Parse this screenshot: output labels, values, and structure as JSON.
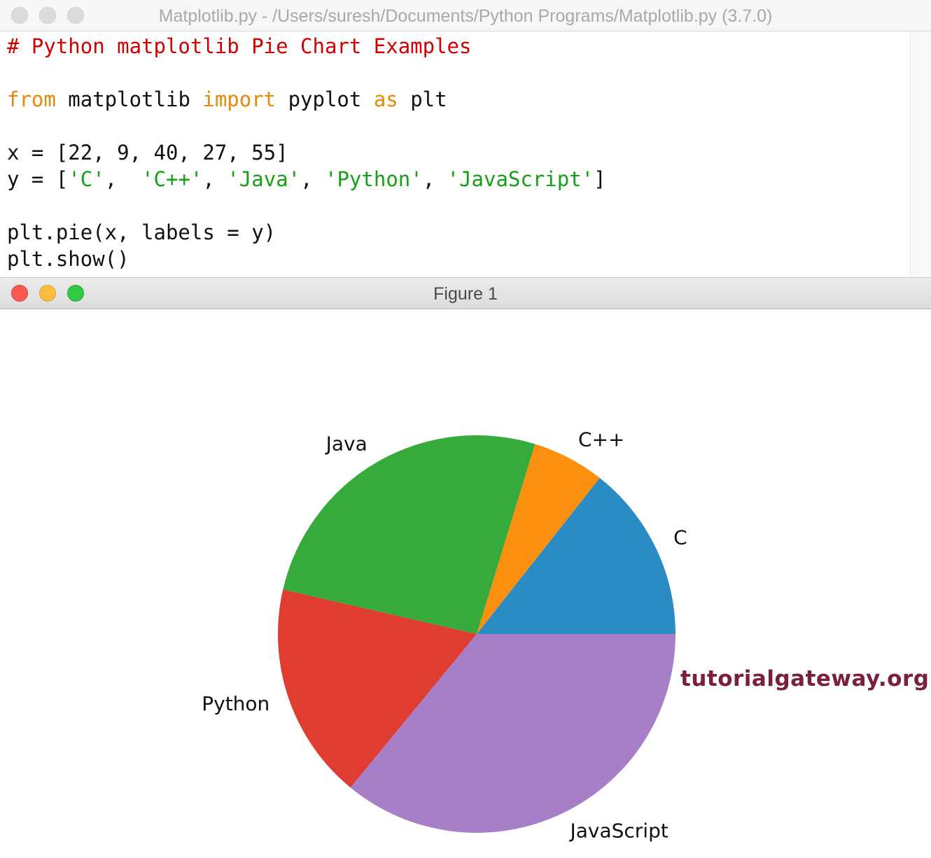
{
  "editor": {
    "title": "Matplotlib.py - /Users/suresh/Documents/Python Programs/Matplotlib.py (3.7.0)",
    "code": {
      "comment": "# Python matplotlib Pie Chart Examples",
      "import_from": "from",
      "import_module": " matplotlib ",
      "import_kw": "import",
      "import_name": " pyplot ",
      "import_as": "as",
      "import_alias": " plt",
      "x_line": "x = [22, 9, 40, 27, 55]",
      "y_prefix": "y = [",
      "y_str1": "'C'",
      "y_sep1": ",  ",
      "y_str2": "'C++'",
      "y_sep2": ", ",
      "y_str3": "'Java'",
      "y_sep3": ", ",
      "y_str4": "'Python'",
      "y_sep4": ", ",
      "y_str5": "'JavaScript'",
      "y_suffix": "]",
      "pie_line": "plt.pie(x, labels = y)",
      "show_line": "plt.show()"
    }
  },
  "figure": {
    "title": "Figure 1",
    "watermark": "tutorialgateway.org"
  },
  "chart_data": {
    "type": "pie",
    "categories": [
      "C",
      "C++",
      "Java",
      "Python",
      "JavaScript"
    ],
    "values": [
      22,
      9,
      40,
      27,
      55
    ],
    "colors": [
      "#2b8cc4",
      "#fb8f0f",
      "#36ab3b",
      "#df3c32",
      "#a77fc9"
    ],
    "start_angle_deg": 0,
    "direction": "counterclockwise"
  }
}
